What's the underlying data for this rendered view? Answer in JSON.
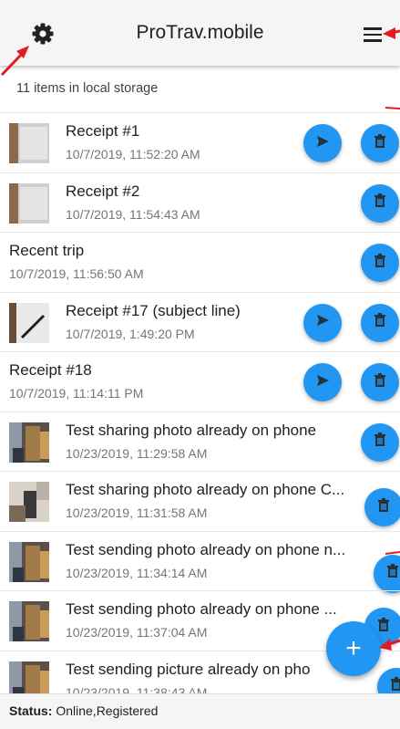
{
  "header": {
    "title": "ProTrav.mobile",
    "settings_icon": "gear-icon",
    "menu_icon": "hamburger-menu-icon"
  },
  "storage_text": "11 items in local storage",
  "items": [
    {
      "name": "Receipt #1",
      "date": "10/7/2019, 11:52:20 AM",
      "thumb": "receipt",
      "send": true
    },
    {
      "name": "Receipt #2",
      "date": "10/7/2019, 11:54:43 AM",
      "thumb": "receipt",
      "send": false
    },
    {
      "name": "Recent trip",
      "date": "10/7/2019, 11:56:50 AM",
      "thumb": "none",
      "send": false
    },
    {
      "name": "Receipt #17 (subject line)",
      "date": "10/7/2019, 1:49:20 PM",
      "thumb": "pen",
      "send": true
    },
    {
      "name": "Receipt #18",
      "date": "10/7/2019, 11:14:11 PM",
      "thumb": "none",
      "send": true
    },
    {
      "name": "Test sharing photo already on phone",
      "date": "10/23/2019, 11:29:58 AM",
      "thumb": "photo",
      "send": false
    },
    {
      "name": "Test sharing photo already on phone C...",
      "date": "10/23/2019, 11:31:58 AM",
      "thumb": "photo2",
      "send": false
    },
    {
      "name": "Test sending photo already on phone n...",
      "date": "10/23/2019, 11:34:14 AM",
      "thumb": "photo",
      "send": false
    },
    {
      "name": "Test sending photo already on phone ...",
      "date": "10/23/2019, 11:37:04 AM",
      "thumb": "photo",
      "send": false
    },
    {
      "name": "Test sending picture already on pho",
      "date": "10/23/2019, 11:38:43 AM",
      "thumb": "photo",
      "send": false
    }
  ],
  "add_button": {
    "label": "+"
  },
  "status": {
    "label": "Status:",
    "value": " Online,Registered"
  },
  "colors": {
    "accent": "#2196f3",
    "annotation_arrow": "#e11b22"
  }
}
